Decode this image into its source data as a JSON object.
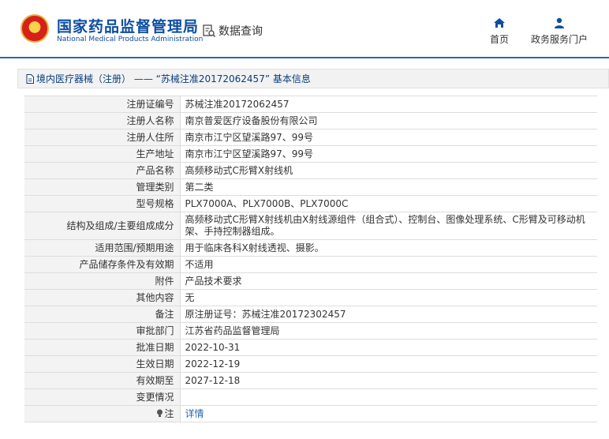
{
  "header": {
    "site_title": "国家药品监督管理局",
    "site_subtitle": "National Medical Products Administration",
    "data_query_label": "数据查询",
    "nav": [
      {
        "label": "首页",
        "icon": "home-icon"
      },
      {
        "label": "政务服务门户",
        "icon": "user-icon"
      }
    ]
  },
  "breadcrumb": {
    "text": "境内医疗器械（注册） —— “苏械注准20172062457”  基本信息"
  },
  "table": {
    "rows": [
      {
        "label": "注册证编号",
        "value": "苏械注准20172062457"
      },
      {
        "label": "注册人名称",
        "value": "南京普爱医疗设备股份有限公司"
      },
      {
        "label": "注册人住所",
        "value": "南京市江宁区望溪路97、99号"
      },
      {
        "label": "生产地址",
        "value": "南京市江宁区望溪路97、99号"
      },
      {
        "label": "产品名称",
        "value": "高频移动式C形臂X射线机"
      },
      {
        "label": "管理类别",
        "value": "第二类"
      },
      {
        "label": "型号规格",
        "value": "PLX7000A、PLX7000B、PLX7000C"
      },
      {
        "label": "结构及组成/主要组成成分",
        "value": "高频移动式C形臂X射线机由X射线源组件（组合式）、控制台、图像处理系统、C形臂及可移动机架、手持控制器组成。"
      },
      {
        "label": "适用范围/预期用途",
        "value": "用于临床各科X射线透视、摄影。"
      },
      {
        "label": "产品储存条件及有效期",
        "value": "不适用"
      },
      {
        "label": "附件",
        "value": "产品技术要求"
      },
      {
        "label": "其他内容",
        "value": "无"
      },
      {
        "label": "备注",
        "value": "原注册证号：苏械注准20172302457"
      },
      {
        "label": "审批部门",
        "value": "江苏省药品监督管理局"
      },
      {
        "label": "批准日期",
        "value": "2022-10-31"
      },
      {
        "label": "生效日期",
        "value": "2022-12-19"
      },
      {
        "label": "有效期至",
        "value": "2027-12-18"
      },
      {
        "label": "变更情况",
        "value": ""
      },
      {
        "label": "注",
        "value": "详情",
        "icon": "lightbulb-icon"
      }
    ]
  },
  "colors": {
    "brand_blue": "#0d4d9f",
    "header_rule": "#2b66b1",
    "link": "#2b66b1",
    "label_bg": "#f3f3f3"
  }
}
